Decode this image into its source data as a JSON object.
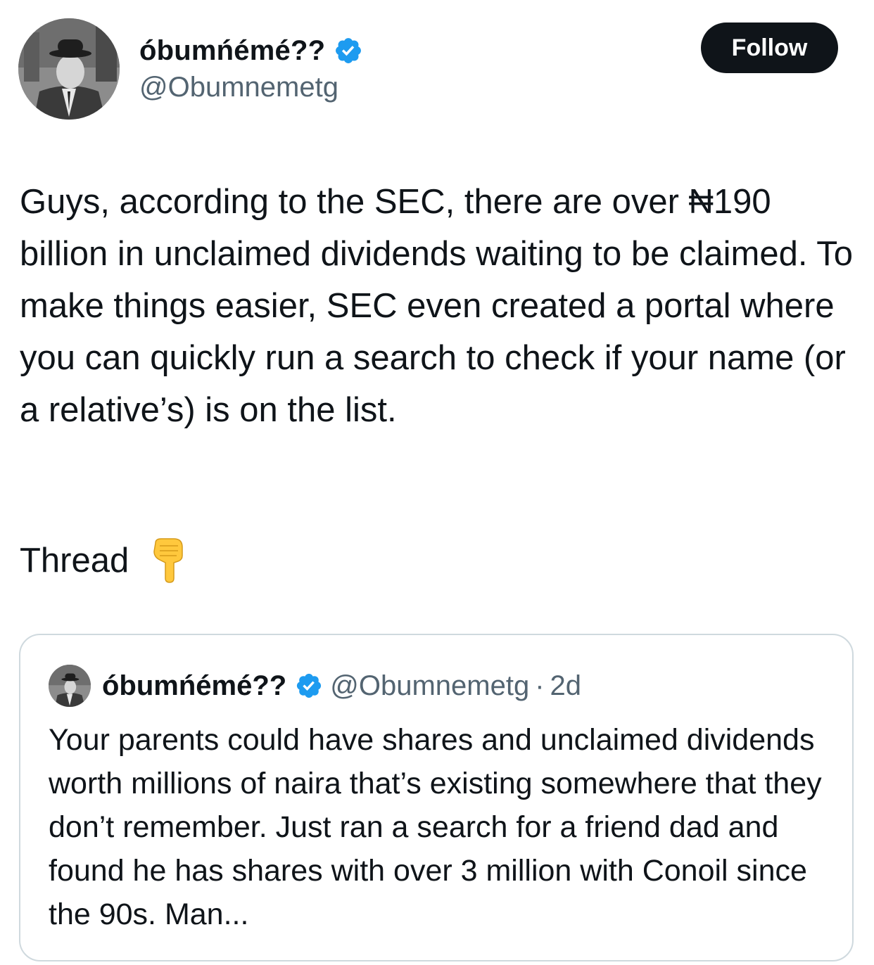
{
  "author": {
    "display_name": "óbumńémé??",
    "handle": "@Obumnemetg",
    "avatar_icon": "profile-photo-man-in-hat",
    "verified_icon": "verified-badge-icon",
    "verified_color": "#1d9bf0"
  },
  "follow_button": {
    "label": "Follow"
  },
  "tweet": {
    "text": "Guys, according to the SEC, there are over ₦190 billion in unclaimed dividends waiting to be claimed. To make things easier, SEC even created a portal where you can quickly run a search to check if your name (or a relative’s) is on the list.",
    "thread_label": "Thread",
    "emoji_icon": "backhand-index-pointing-down-emoji"
  },
  "quote": {
    "display_name": "óbumńémé??",
    "handle": "@Obumnemetg",
    "separator": "·",
    "time": "2d",
    "text": "Your parents could have shares and unclaimed dividends worth millions of naira that’s existing somewhere that they don’t remember. Just ran a search for a friend dad and found he has shares with over 3 million with Conoil since the 90s. Man..."
  },
  "colors": {
    "text": "#0f1419",
    "secondary_text": "#536471",
    "border": "#cfd9de",
    "button_bg": "#0f1419",
    "verified": "#1d9bf0"
  }
}
